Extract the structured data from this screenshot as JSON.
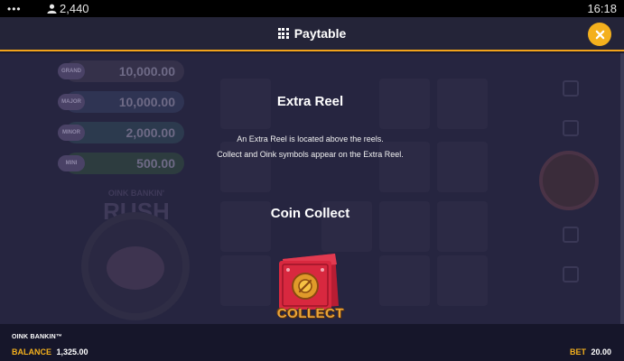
{
  "status_bar": {
    "menu_dots": "•••",
    "player_count": "2,440",
    "time": "16:18"
  },
  "header": {
    "title": "Paytable",
    "close_icon": "close-icon"
  },
  "paytable": {
    "sections": [
      {
        "title": "Extra Reel",
        "lines": [
          "An Extra Reel is located above the reels.",
          "Collect and Oink symbols appear on the Extra Reel."
        ]
      },
      {
        "title": "Coin Collect",
        "symbol_label": "COLLECT"
      }
    ]
  },
  "background_game": {
    "jackpots": [
      {
        "tag": "GRAND",
        "value": "10,000.00"
      },
      {
        "tag": "MAJOR",
        "value": "10,000.00"
      },
      {
        "tag": "MINOR",
        "value": "2,000.00"
      },
      {
        "tag": "MINI",
        "value": "500.00"
      }
    ],
    "logo_line1": "OINK BANKIN'",
    "logo_line2": "RUSH"
  },
  "footer": {
    "game_name": "OINK BANKIN™",
    "balance_label": "BALANCE",
    "balance_value": "1,325.00",
    "bet_label": "BET",
    "bet_value": "20.00"
  },
  "colors": {
    "accent": "#f4b01d",
    "header_bg": "#242438",
    "divider": "#f2a31b",
    "symbol_red": "#d8283f"
  }
}
